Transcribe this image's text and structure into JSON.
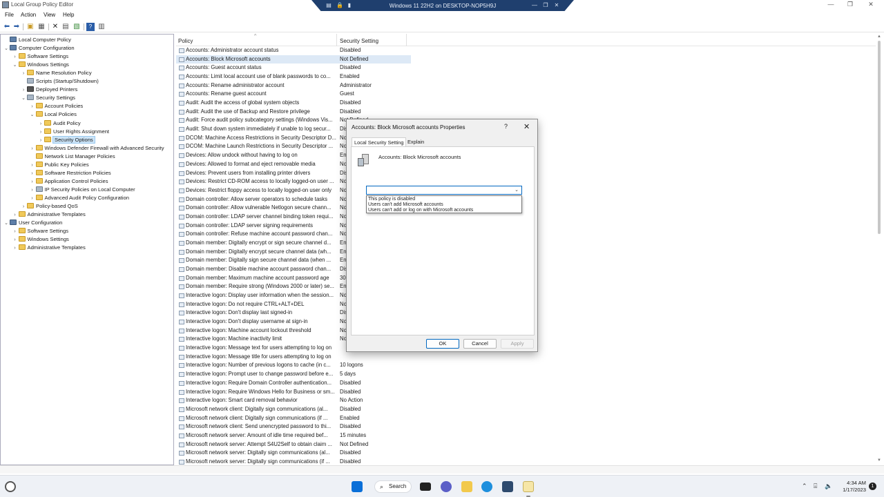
{
  "window": {
    "title": "Local Group Policy Editor",
    "minimize": "—",
    "restore": "❐",
    "close": "✕"
  },
  "vm_bar": {
    "title": "Windows 11 22H2 on DESKTOP-NOP5H9J"
  },
  "menu": [
    "File",
    "Action",
    "View",
    "Help"
  ],
  "tree": [
    {
      "label": "Local Computer Policy",
      "level": 0,
      "chev": "",
      "icon": "pc"
    },
    {
      "label": "Computer Configuration",
      "level": 0,
      "chev": "⌄",
      "icon": "pc"
    },
    {
      "label": "Software Settings",
      "level": 1,
      "chev": "›",
      "icon": "folder"
    },
    {
      "label": "Windows Settings",
      "level": 1,
      "chev": "⌄",
      "icon": "folder"
    },
    {
      "label": "Name Resolution Policy",
      "level": 2,
      "chev": "›",
      "icon": "folder"
    },
    {
      "label": "Scripts (Startup/Shutdown)",
      "level": 2,
      "chev": "",
      "icon": "shield"
    },
    {
      "label": "Deployed Printers",
      "level": 2,
      "chev": "›",
      "icon": "printer"
    },
    {
      "label": "Security Settings",
      "level": 2,
      "chev": "⌄",
      "icon": "shield"
    },
    {
      "label": "Account Policies",
      "level": 3,
      "chev": "›",
      "icon": "folder"
    },
    {
      "label": "Local Policies",
      "level": 3,
      "chev": "⌄",
      "icon": "folder"
    },
    {
      "label": "Audit Policy",
      "level": 4,
      "chev": "›",
      "icon": "folder"
    },
    {
      "label": "User Rights Assignment",
      "level": 4,
      "chev": "›",
      "icon": "folder"
    },
    {
      "label": "Security Options",
      "level": 4,
      "chev": "›",
      "icon": "folder",
      "selected": true
    },
    {
      "label": "Windows Defender Firewall with Advanced Security",
      "level": 3,
      "chev": "›",
      "icon": "folder"
    },
    {
      "label": "Network List Manager Policies",
      "level": 3,
      "chev": "",
      "icon": "folder"
    },
    {
      "label": "Public Key Policies",
      "level": 3,
      "chev": "›",
      "icon": "folder"
    },
    {
      "label": "Software Restriction Policies",
      "level": 3,
      "chev": "›",
      "icon": "folder"
    },
    {
      "label": "Application Control Policies",
      "level": 3,
      "chev": "›",
      "icon": "folder"
    },
    {
      "label": "IP Security Policies on Local Computer",
      "level": 3,
      "chev": "›",
      "icon": "shield"
    },
    {
      "label": "Advanced Audit Policy Configuration",
      "level": 3,
      "chev": "›",
      "icon": "folder"
    },
    {
      "label": "Policy-based QoS",
      "level": 2,
      "chev": "›",
      "icon": "folder"
    },
    {
      "label": "Administrative Templates",
      "level": 1,
      "chev": "›",
      "icon": "folder"
    },
    {
      "label": "User Configuration",
      "level": 0,
      "chev": "⌄",
      "icon": "pc"
    },
    {
      "label": "Software Settings",
      "level": 1,
      "chev": "›",
      "icon": "folder"
    },
    {
      "label": "Windows Settings",
      "level": 1,
      "chev": "›",
      "icon": "folder"
    },
    {
      "label": "Administrative Templates",
      "level": 1,
      "chev": "›",
      "icon": "folder"
    }
  ],
  "list": {
    "col_policy": "Policy",
    "col_setting": "Security Setting",
    "rows": [
      {
        "policy": "Accounts: Administrator account status",
        "setting": "Disabled"
      },
      {
        "policy": "Accounts: Block Microsoft accounts",
        "setting": "Not Defined",
        "selected": true
      },
      {
        "policy": "Accounts: Guest account status",
        "setting": "Disabled"
      },
      {
        "policy": "Accounts: Limit local account use of blank passwords to co...",
        "setting": "Enabled"
      },
      {
        "policy": "Accounts: Rename administrator account",
        "setting": "Administrator"
      },
      {
        "policy": "Accounts: Rename guest account",
        "setting": "Guest"
      },
      {
        "policy": "Audit: Audit the access of global system objects",
        "setting": "Disabled"
      },
      {
        "policy": "Audit: Audit the use of Backup and Restore privilege",
        "setting": "Disabled"
      },
      {
        "policy": "Audit: Force audit policy subcategory settings (Windows Vis...",
        "setting": "Not Defined"
      },
      {
        "policy": "Audit: Shut down system immediately if unable to log secur...",
        "setting": "Disabled"
      },
      {
        "policy": "DCOM: Machine Access Restrictions in Security Descriptor D...",
        "setting": "Not Defined"
      },
      {
        "policy": "DCOM: Machine Launch Restrictions in Security Descriptor ...",
        "setting": "Not Defined"
      },
      {
        "policy": "Devices: Allow undock without having to log on",
        "setting": "Enabled"
      },
      {
        "policy": "Devices: Allowed to format and eject removable media",
        "setting": "Not Defined"
      },
      {
        "policy": "Devices: Prevent users from installing printer drivers",
        "setting": "Disabled"
      },
      {
        "policy": "Devices: Restrict CD-ROM access to locally logged-on user ...",
        "setting": "Not Defined"
      },
      {
        "policy": "Devices: Restrict floppy access to locally logged-on user only",
        "setting": "Not Defined"
      },
      {
        "policy": "Domain controller: Allow server operators to schedule tasks",
        "setting": "Not Defined"
      },
      {
        "policy": "Domain controller: Allow vulnerable Netlogon secure chann...",
        "setting": "Not Defined"
      },
      {
        "policy": "Domain controller: LDAP server channel binding token requi...",
        "setting": "Not Defined"
      },
      {
        "policy": "Domain controller: LDAP server signing requirements",
        "setting": "Not Defined"
      },
      {
        "policy": "Domain controller: Refuse machine account password chan...",
        "setting": "Not Defined"
      },
      {
        "policy": "Domain member: Digitally encrypt or sign secure channel d...",
        "setting": "Enabled"
      },
      {
        "policy": "Domain member: Digitally encrypt secure channel data (wh...",
        "setting": "Enabled"
      },
      {
        "policy": "Domain member: Digitally sign secure channel data (when ...",
        "setting": "Enabled"
      },
      {
        "policy": "Domain member: Disable machine account password chan...",
        "setting": "Disabled"
      },
      {
        "policy": "Domain member: Maximum machine account password age",
        "setting": "30 days"
      },
      {
        "policy": "Domain member: Require strong (Windows 2000 or later) se...",
        "setting": "Enabled"
      },
      {
        "policy": "Interactive logon: Display user information when the session...",
        "setting": "Not Defined"
      },
      {
        "policy": "Interactive logon: Do not require CTRL+ALT+DEL",
        "setting": "Not Defined"
      },
      {
        "policy": "Interactive logon: Don't display last signed-in",
        "setting": "Disabled"
      },
      {
        "policy": "Interactive logon: Don't display username at sign-in",
        "setting": "Not Defined"
      },
      {
        "policy": "Interactive logon: Machine account lockout threshold",
        "setting": "Not Defined"
      },
      {
        "policy": "Interactive logon: Machine inactivity limit",
        "setting": "Not Defined"
      },
      {
        "policy": "Interactive logon: Message text for users attempting to log on",
        "setting": ""
      },
      {
        "policy": "Interactive logon: Message title for users attempting to log on",
        "setting": ""
      },
      {
        "policy": "Interactive logon: Number of previous logons to cache (in c...",
        "setting": "10 logons"
      },
      {
        "policy": "Interactive logon: Prompt user to change password before e...",
        "setting": "5 days"
      },
      {
        "policy": "Interactive logon: Require Domain Controller authentication...",
        "setting": "Disabled"
      },
      {
        "policy": "Interactive logon: Require Windows Hello for Business or sm...",
        "setting": "Disabled"
      },
      {
        "policy": "Interactive logon: Smart card removal behavior",
        "setting": "No Action"
      },
      {
        "policy": "Microsoft network client: Digitally sign communications (al...",
        "setting": "Disabled"
      },
      {
        "policy": "Microsoft network client: Digitally sign communications (if ...",
        "setting": "Enabled"
      },
      {
        "policy": "Microsoft network client: Send unencrypted password to thi...",
        "setting": "Disabled"
      },
      {
        "policy": "Microsoft network server: Amount of idle time required bef...",
        "setting": "15 minutes"
      },
      {
        "policy": "Microsoft network server: Attempt S4U2Self to obtain claim ...",
        "setting": "Not Defined"
      },
      {
        "policy": "Microsoft network server: Digitally sign communications (al...",
        "setting": "Disabled"
      },
      {
        "policy": "Microsoft network server: Digitally sign communications (if ...",
        "setting": "Disabled"
      }
    ]
  },
  "dialog": {
    "title": "Accounts: Block Microsoft accounts Properties",
    "help": "?",
    "close": "✕",
    "tab_local": "Local Security Setting",
    "tab_explain": "Explain",
    "policy_name": "Accounts: Block Microsoft accounts",
    "combo_value": "",
    "options": [
      "This policy is disabled",
      "Users can't add Microsoft accounts",
      "Users can't add or log on with Microsoft accounts"
    ],
    "ok": "OK",
    "cancel": "Cancel",
    "apply": "Apply"
  },
  "taskbar": {
    "search": "Search",
    "time": "4:34 AM",
    "date": "1/17/2023",
    "notifications": "1"
  },
  "colors": {
    "accent": "#0067c0",
    "selection": "#cce4f7",
    "folder": "#f0c95a",
    "vm_bar": "#1f3f6e"
  }
}
